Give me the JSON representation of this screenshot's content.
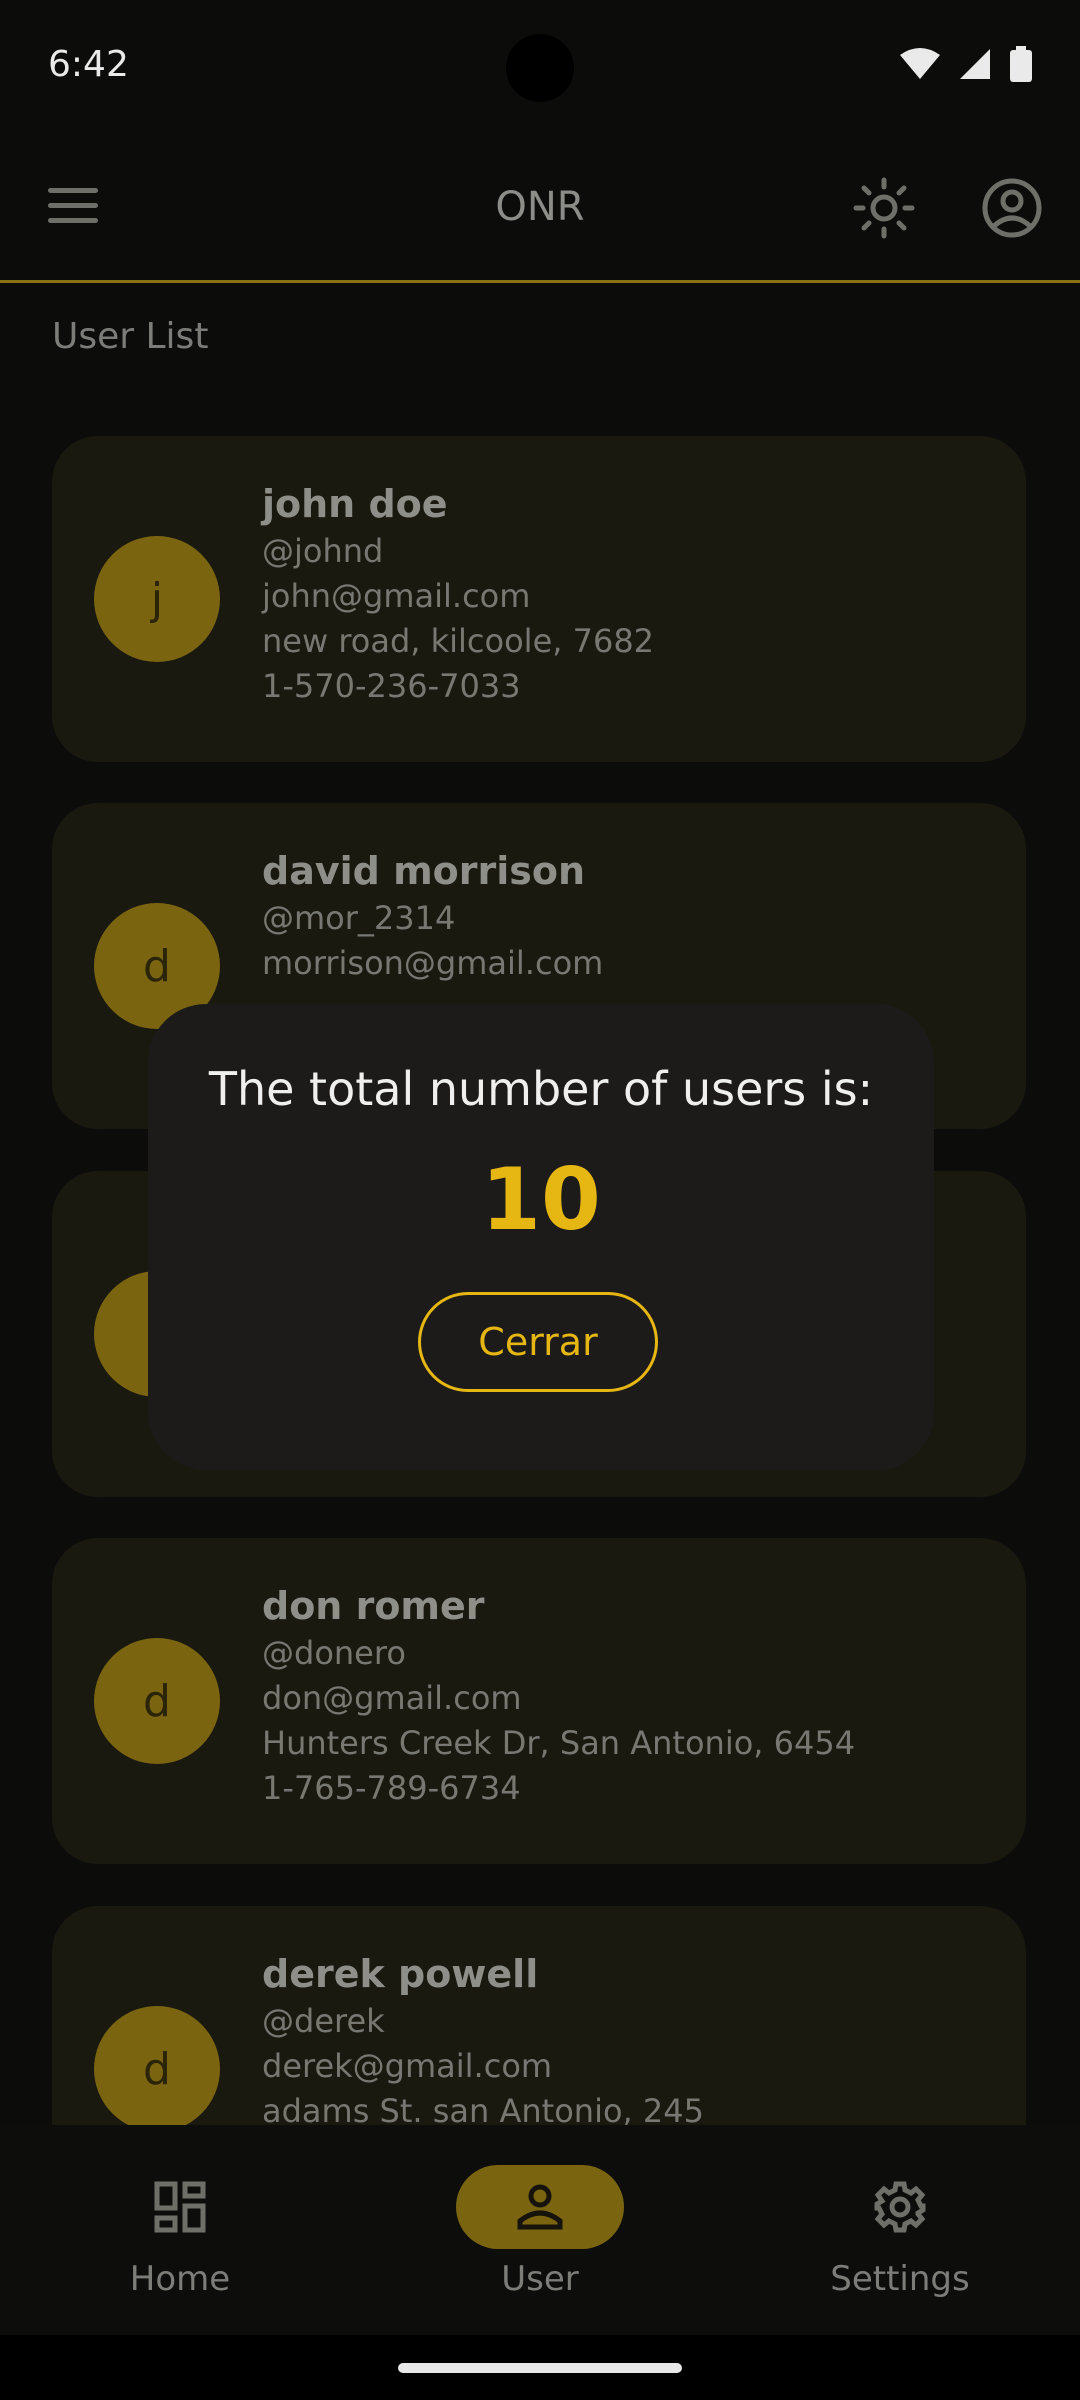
{
  "status": {
    "time": "6:42"
  },
  "app_bar": {
    "title": "ONR"
  },
  "section": {
    "title": "User List"
  },
  "users": [
    {
      "initial": "j",
      "name": "john doe",
      "username": "@johnd",
      "email": "john@gmail.com",
      "address": "new road, kilcoole, 7682",
      "phone": "1-570-236-7033"
    },
    {
      "initial": "d",
      "name": "david morrison",
      "username": "@mor_2314",
      "email": "morrison@gmail.com",
      "address": "",
      "phone": ""
    },
    {
      "initial": "",
      "name": "",
      "username": "",
      "email": "",
      "address": "",
      "phone": ""
    },
    {
      "initial": "d",
      "name": "don romer",
      "username": "@donero",
      "email": "don@gmail.com",
      "address": "Hunters Creek Dr, San Antonio, 6454",
      "phone": "1-765-789-6734"
    },
    {
      "initial": "d",
      "name": "derek powell",
      "username": "@derek",
      "email": "derek@gmail.com",
      "address": "adams St. san Antonio, 245",
      "phone": ""
    }
  ],
  "dialog": {
    "message": "The total number of users is:",
    "count": "10",
    "close_label": "Cerrar"
  },
  "bottom_nav": [
    {
      "label": "Home",
      "icon": "dashboard-icon",
      "active": false
    },
    {
      "label": "User",
      "icon": "person-icon",
      "active": true
    },
    {
      "label": "Settings",
      "icon": "gear-icon",
      "active": false
    }
  ],
  "colors": {
    "accent": "#e6b612",
    "card_bg": "#1a1910",
    "avatar_bg": "#7a6410",
    "background": "#0c0c0b"
  }
}
